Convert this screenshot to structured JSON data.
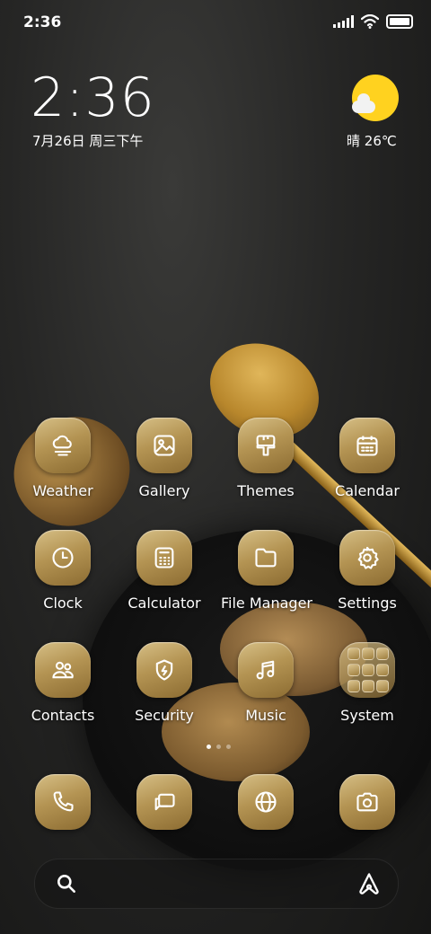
{
  "status_bar": {
    "time": "2:36"
  },
  "clock_widget": {
    "time": "2:36",
    "date": "7月26日 周三下午"
  },
  "weather_widget": {
    "condition": "晴",
    "temperature": "26℃",
    "sun_color": "#ffd21f"
  },
  "apps": {
    "weather": "Weather",
    "gallery": "Gallery",
    "themes": "Themes",
    "calendar": "Calendar",
    "clock": "Clock",
    "calculator": "Calculator",
    "file_manager": "File Manager",
    "settings": "Settings",
    "contacts": "Contacts",
    "security": "Security",
    "music": "Music",
    "system": "System"
  },
  "dock": [
    "phone-icon",
    "messages-icon",
    "browser-icon",
    "camera-icon"
  ],
  "page_indicator": {
    "pages": 3,
    "current": 1
  },
  "theme": {
    "icon_gold": "#b49453"
  }
}
